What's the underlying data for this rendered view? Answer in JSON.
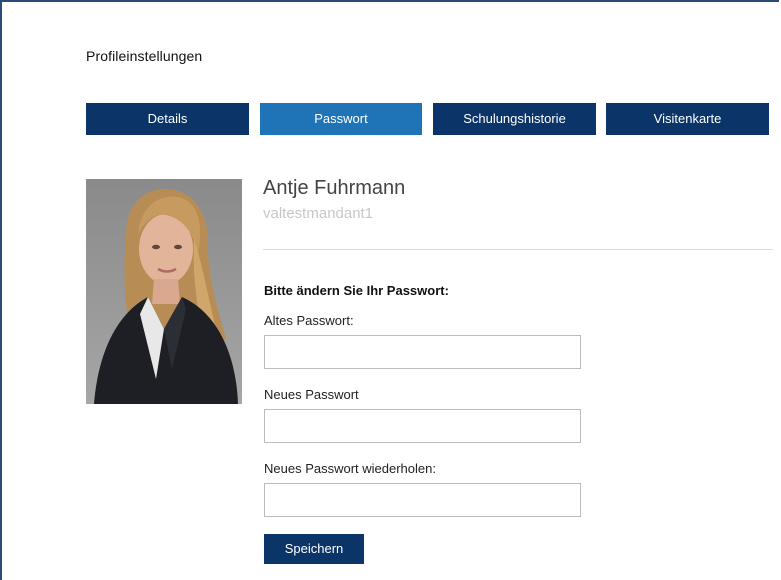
{
  "header": {
    "title": "Profileinstellungen"
  },
  "tabs": [
    {
      "label": "Details",
      "active": false
    },
    {
      "label": "Passwort",
      "active": true
    },
    {
      "label": "Schulungshistorie",
      "active": false
    },
    {
      "label": "Visitenkarte",
      "active": false
    }
  ],
  "profile": {
    "name": "Antje Fuhrmann",
    "tenant": "valtestmandant1"
  },
  "password_form": {
    "heading": "Bitte ändern Sie Ihr Passwort:",
    "old_label": "Altes Passwort:",
    "old_value": "",
    "new_label": "Neues Passwort",
    "new_value": "",
    "repeat_label": "Neues Passwort wiederholen:",
    "repeat_value": "",
    "save_label": "Speichern"
  },
  "colors": {
    "tab_bg": "#0b3468",
    "tab_active_bg": "#1f74b8",
    "frame_border": "#2a4a7a"
  }
}
